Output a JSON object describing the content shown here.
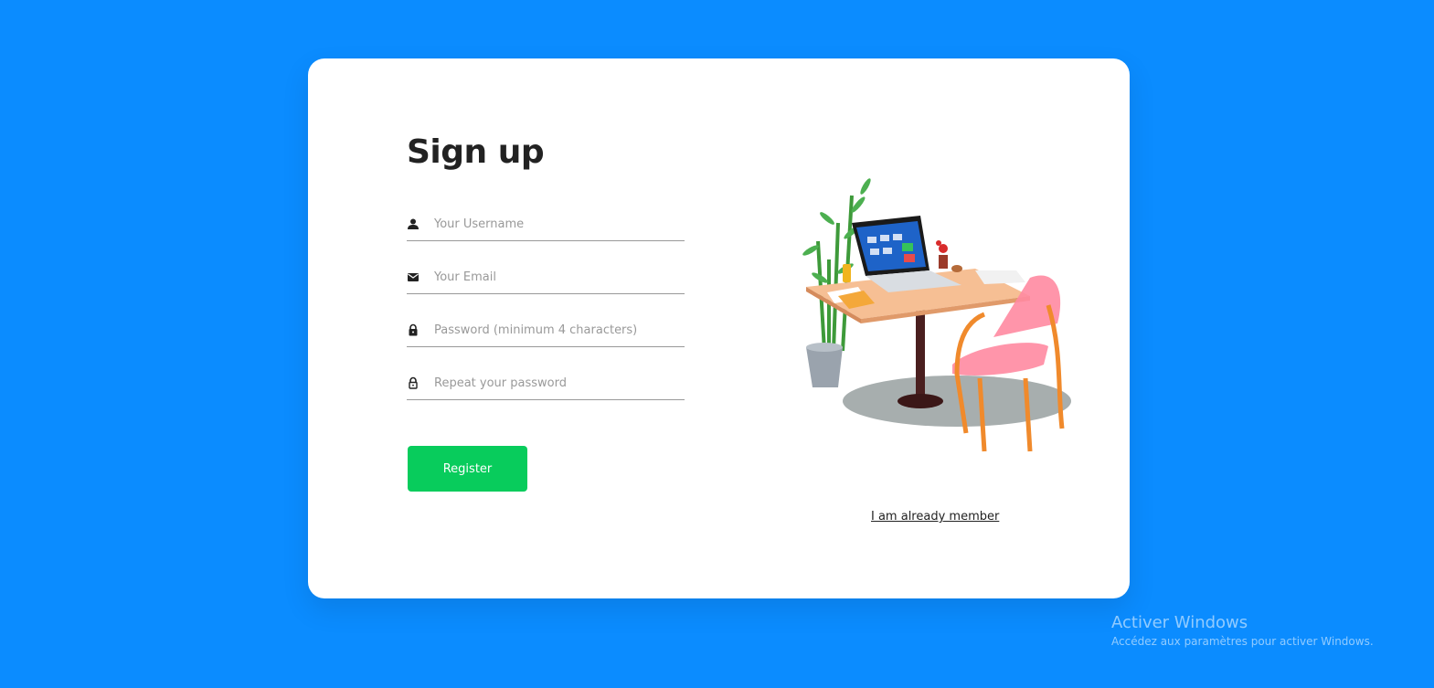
{
  "signup": {
    "title": "Sign up",
    "fields": [
      {
        "icon": "user-icon",
        "placeholder": "Your Username",
        "value": ""
      },
      {
        "icon": "email-icon",
        "placeholder": "Your Email",
        "value": ""
      },
      {
        "icon": "lock-icon",
        "placeholder": "Password (minimum 4 characters)",
        "value": ""
      },
      {
        "icon": "lock-outline-icon",
        "placeholder": "Repeat your password",
        "value": ""
      }
    ],
    "register_label": "Register",
    "member_link": "I am already member"
  },
  "illustration": {
    "icon": "desk-illustration"
  },
  "watermark": {
    "title": "Activer Windows",
    "subtitle": "Accédez aux paramètres pour activer Windows."
  },
  "colors": {
    "background": "#0b8cff",
    "card": "#ffffff",
    "register_button": "#08cc5c",
    "title": "#222222"
  }
}
